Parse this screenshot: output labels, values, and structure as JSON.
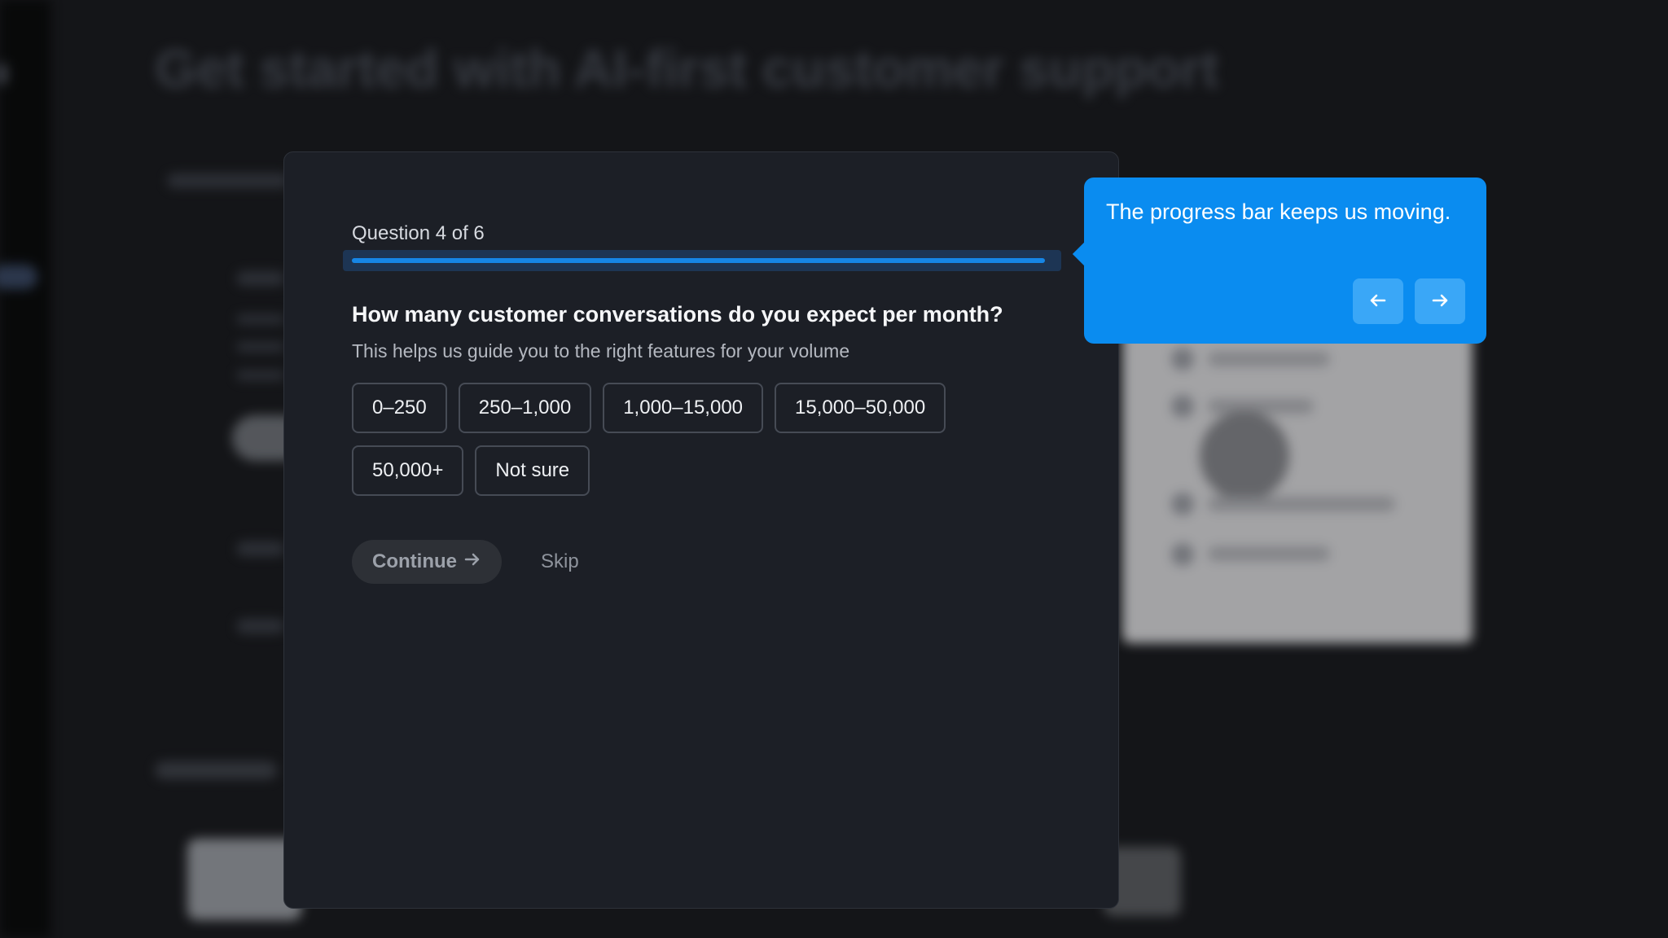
{
  "background": {
    "title": "Get started with AI-first customer support"
  },
  "modal": {
    "question_counter": "Question 4 of 6",
    "progress_fraction": 0.99,
    "question": "How many customer conversations do you expect per month?",
    "subtitle": "This helps us guide you to the right features for your volume",
    "options": [
      "0–250",
      "250–1,000",
      "1,000–15,000",
      "15,000–50,000",
      "50,000+",
      "Not sure"
    ],
    "continue_label": "Continue",
    "continue_icon": "arrow-right-icon",
    "skip_label": "Skip"
  },
  "tooltip": {
    "text": "The progress bar keeps us moving.",
    "prev_icon": "arrow-left-icon",
    "next_icon": "arrow-right-icon"
  },
  "colors": {
    "accent": "#1686e6",
    "tooltip_bg": "#0a8cf0",
    "modal_bg": "#1c1f26"
  }
}
